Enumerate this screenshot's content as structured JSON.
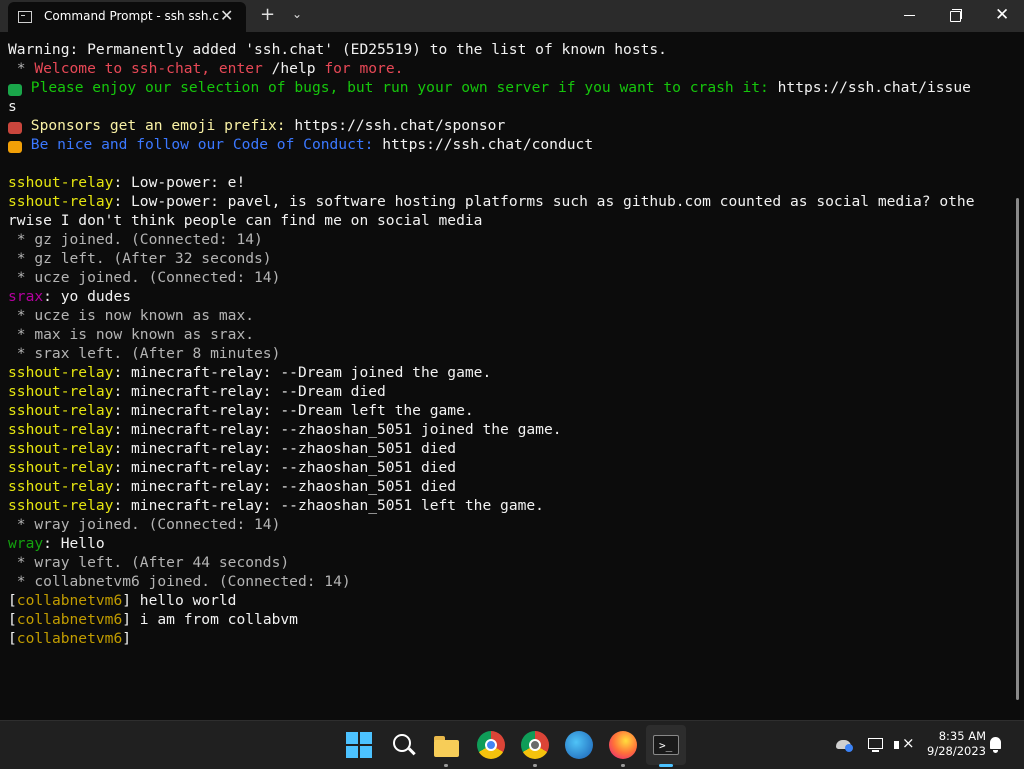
{
  "window": {
    "tab_title": "Command Prompt - ssh  ssh.c",
    "tab_close": "✕",
    "new_tab": "+",
    "tab_dropdown": "⌄"
  },
  "terminal": {
    "lines": [
      {
        "segments": [
          {
            "t": "Warning: Permanently added 'ssh.chat' (ED25519) to the list of known hosts.",
            "c": "white"
          }
        ]
      },
      {
        "segments": [
          {
            "t": " * ",
            "c": "gray"
          },
          {
            "t": "Welcome to ssh-chat, enter ",
            "c": "red"
          },
          {
            "t": "/help",
            "c": "white"
          },
          {
            "t": " for more.",
            "c": "red"
          }
        ]
      },
      {
        "segments": [
          {
            "t": "🐛",
            "c": "emoji-bug"
          },
          {
            "t": " Please enjoy our selection of bugs, but run your own server if you want to crash it: ",
            "c": "green"
          },
          {
            "t": "https://ssh.chat/issue",
            "c": "white"
          }
        ]
      },
      {
        "segments": [
          {
            "t": "s",
            "c": "white"
          }
        ]
      },
      {
        "segments": [
          {
            "t": "🎩",
            "c": "emoji-hat"
          },
          {
            "t": " Sponsors get an emoji prefix: ",
            "c": "yellow"
          },
          {
            "t": "https://ssh.chat/sponsor",
            "c": "white"
          }
        ]
      },
      {
        "segments": [
          {
            "t": "😊",
            "c": "emoji-smile"
          },
          {
            "t": " Be nice and follow our Code of Conduct: ",
            "c": "blue"
          },
          {
            "t": "https://ssh.chat/conduct",
            "c": "white"
          }
        ]
      },
      {
        "segments": [
          {
            "t": "",
            "c": "white"
          }
        ]
      },
      {
        "segments": [
          {
            "t": "sshout-relay",
            "c": "ylw"
          },
          {
            "t": ": Low-power: e!",
            "c": "white"
          }
        ]
      },
      {
        "segments": [
          {
            "t": "sshout-relay",
            "c": "ylw"
          },
          {
            "t": ": Low-power: pavel, is software hosting platforms such as github.com counted as social media? othe",
            "c": "white"
          }
        ]
      },
      {
        "segments": [
          {
            "t": "rwise I don't think people can find me on social media",
            "c": "white"
          }
        ]
      },
      {
        "segments": [
          {
            "t": " * gz joined. (Connected: 14)",
            "c": "gray"
          }
        ]
      },
      {
        "segments": [
          {
            "t": " * gz left. (After 32 seconds)",
            "c": "gray"
          }
        ]
      },
      {
        "segments": [
          {
            "t": " * ucze joined. (Connected: 14)",
            "c": "gray"
          }
        ]
      },
      {
        "segments": [
          {
            "t": "srax",
            "c": "magenta"
          },
          {
            "t": ": yo dudes",
            "c": "white"
          }
        ]
      },
      {
        "segments": [
          {
            "t": " * ucze is now known as max.",
            "c": "gray"
          }
        ]
      },
      {
        "segments": [
          {
            "t": " * max is now known as srax.",
            "c": "gray"
          }
        ]
      },
      {
        "segments": [
          {
            "t": " * srax left. (After 8 minutes)",
            "c": "gray"
          }
        ]
      },
      {
        "segments": [
          {
            "t": "sshout-relay",
            "c": "ylw"
          },
          {
            "t": ": minecraft-relay: --Dream joined the game.",
            "c": "white"
          }
        ]
      },
      {
        "segments": [
          {
            "t": "sshout-relay",
            "c": "ylw"
          },
          {
            "t": ": minecraft-relay: --Dream died",
            "c": "white"
          }
        ]
      },
      {
        "segments": [
          {
            "t": "sshout-relay",
            "c": "ylw"
          },
          {
            "t": ": minecraft-relay: --Dream left the game.",
            "c": "white"
          }
        ]
      },
      {
        "segments": [
          {
            "t": "sshout-relay",
            "c": "ylw"
          },
          {
            "t": ": minecraft-relay: --zhaoshan_5051 joined the game.",
            "c": "white"
          }
        ]
      },
      {
        "segments": [
          {
            "t": "sshout-relay",
            "c": "ylw"
          },
          {
            "t": ": minecraft-relay: --zhaoshan_5051 died",
            "c": "white"
          }
        ]
      },
      {
        "segments": [
          {
            "t": "sshout-relay",
            "c": "ylw"
          },
          {
            "t": ": minecraft-relay: --zhaoshan_5051 died",
            "c": "white"
          }
        ]
      },
      {
        "segments": [
          {
            "t": "sshout-relay",
            "c": "ylw"
          },
          {
            "t": ": minecraft-relay: --zhaoshan_5051 died",
            "c": "white"
          }
        ]
      },
      {
        "segments": [
          {
            "t": "sshout-relay",
            "c": "ylw"
          },
          {
            "t": ": minecraft-relay: --zhaoshan_5051 left the game.",
            "c": "white"
          }
        ]
      },
      {
        "segments": [
          {
            "t": " * wray joined. (Connected: 14)",
            "c": "gray"
          }
        ]
      },
      {
        "segments": [
          {
            "t": "wray",
            "c": "lgreen"
          },
          {
            "t": ": Hello",
            "c": "white"
          }
        ]
      },
      {
        "segments": [
          {
            "t": " * wray left. (After 44 seconds)",
            "c": "gray"
          }
        ]
      },
      {
        "segments": [
          {
            "t": " * collabnetvm6 joined. (Connected: 14)",
            "c": "gray"
          }
        ]
      },
      {
        "segments": [
          {
            "t": "[",
            "c": "white"
          },
          {
            "t": "collabnetvm6",
            "c": "orange"
          },
          {
            "t": "] hello world",
            "c": "white"
          }
        ]
      },
      {
        "segments": [
          {
            "t": "[",
            "c": "white"
          },
          {
            "t": "collabnetvm6",
            "c": "orange"
          },
          {
            "t": "] i am from collabvm",
            "c": "white"
          }
        ]
      },
      {
        "segments": [
          {
            "t": "[",
            "c": "white"
          },
          {
            "t": "collabnetvm6",
            "c": "orange"
          },
          {
            "t": "]",
            "c": "white"
          }
        ]
      }
    ]
  },
  "taskbar": {
    "apps": [
      {
        "name": "start-button",
        "icon": "windows-logo-icon"
      },
      {
        "name": "search-button",
        "icon": "search-icon"
      },
      {
        "name": "file-explorer-button",
        "icon": "folder-icon"
      },
      {
        "name": "chrome-button",
        "icon": "chrome-icon"
      },
      {
        "name": "chrome-dev-button",
        "icon": "chrome-dev-icon"
      },
      {
        "name": "firefox-dev-button",
        "icon": "firefox-developer-icon"
      },
      {
        "name": "firefox-button",
        "icon": "firefox-icon"
      },
      {
        "name": "terminal-button",
        "icon": "terminal-icon"
      }
    ],
    "terminal_glyph": ">_",
    "time": "8:35 AM",
    "date": "9/28/2023"
  },
  "colors": {
    "terminal_bg": "#0c0c0c",
    "titlebar_bg": "#2b2b2b",
    "taskbar_bg": "#202020",
    "accent": "#4cc2ff"
  }
}
